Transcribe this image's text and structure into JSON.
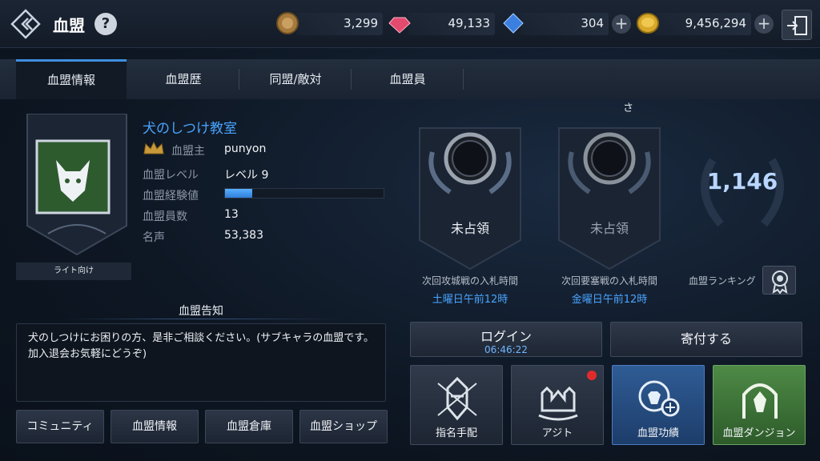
{
  "header": {
    "title": "血盟",
    "help": "?",
    "currencies": [
      {
        "icon": "medal-coin-icon",
        "value": "3,299"
      },
      {
        "icon": "red-gem-icon",
        "value": "49,133"
      },
      {
        "icon": "blue-gem-icon",
        "value": "304"
      },
      {
        "icon": "gold-coin-icon",
        "value": "9,456,294"
      }
    ],
    "plus": "+"
  },
  "tabs": [
    {
      "label": "血盟情報",
      "active": true
    },
    {
      "label": "血盟歴",
      "active": false
    },
    {
      "label": "同盟/敵対",
      "active": false
    },
    {
      "label": "血盟員",
      "active": false
    }
  ],
  "clan": {
    "name": "犬のしつけ教室",
    "caption": "ライト向け",
    "leader_label": "血盟主",
    "leader": "punyon",
    "level_label": "血盟レベル",
    "level": "レベル 9",
    "exp_label": "血盟経験値",
    "exp_fraction": 0.17,
    "members_label": "血盟員数",
    "members": "13",
    "fame_label": "名声",
    "fame": "53,383"
  },
  "notice": {
    "title": "血盟告知",
    "body": "犬のしつけにお困りの方、是非ご相談ください。(サブキャラの血盟です。加入退会お気軽にどうぞ)"
  },
  "bottom_buttons": [
    "コミュニティ",
    "血盟情報",
    "血盟倉庫",
    "血盟ショップ"
  ],
  "castles": [
    {
      "status": "未占領",
      "bid_label": "次回攻城戦の入札時間",
      "bid_time": "土曜日午前12時"
    },
    {
      "status": "未占領",
      "bid_label": "次回要塞戦の入札時間",
      "bid_time": "金曜日午前12時"
    }
  ],
  "ranking": {
    "value": "1,146",
    "label": "血盟ランキング"
  },
  "stray_text": "さ",
  "actions": {
    "login_label": "ログイン",
    "login_timer": "06:46:22",
    "donate_label": "寄付する"
  },
  "tiles": [
    {
      "label": "指名手配",
      "icon": "wanted-helmet-icon"
    },
    {
      "label": "アジト",
      "icon": "hideout-castle-icon"
    },
    {
      "label": "血盟功績",
      "icon": "lion-achievement-icon"
    },
    {
      "label": "血盟ダンジョン",
      "icon": "dungeon-gate-icon"
    }
  ],
  "colors": {
    "accent": "#49a4ff",
    "tab_active": "#3f8fe0",
    "notify": "#e12b2b"
  }
}
